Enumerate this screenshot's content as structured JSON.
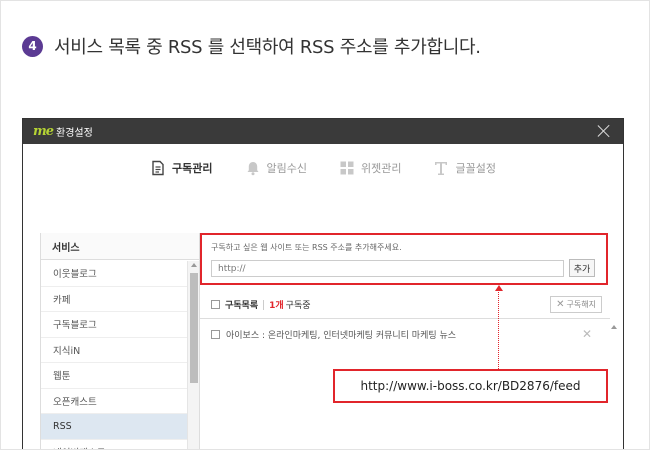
{
  "step": {
    "number": "4",
    "text": "서비스 목록 중 RSS 를 선택하여 RSS 주소를 추가합니다."
  },
  "window": {
    "logo": "me",
    "title": "환경설정"
  },
  "tabs": [
    {
      "label": "구독관리",
      "icon": "document-icon",
      "active": true
    },
    {
      "label": "알림수신",
      "icon": "bell-icon",
      "active": false
    },
    {
      "label": "위젯관리",
      "icon": "grid-icon",
      "active": false
    },
    {
      "label": "글꼴설정",
      "icon": "font-icon",
      "active": false
    }
  ],
  "services": {
    "header": "서비스",
    "items": [
      "이웃블로그",
      "카페",
      "구독블로그",
      "지식iN",
      "웹툰",
      "오픈캐스트",
      "RSS",
      "네이버캐스트"
    ],
    "selected": "RSS"
  },
  "subscribe": {
    "label": "구독하고 싶은 웹 사이트 또는 RSS 주소를 추가해주세요.",
    "input_value": "http://",
    "add_button": "추가",
    "list_title": "구독목록",
    "count": "1개",
    "count_label": "구독중",
    "unsubscribe_button": "구독해지",
    "feeds": [
      "아이보스 : 온라인마케팅, 인터넷마케팅 커뮤니티 마케팅 뉴스"
    ]
  },
  "callout": {
    "url": "http://www.i-boss.co.kr/BD2876/feed"
  },
  "colors": {
    "accent_red": "#e1252b",
    "step_badge": "#5b3a93",
    "titlebar": "#3a3a3a",
    "selected_row": "#dde7f1"
  }
}
